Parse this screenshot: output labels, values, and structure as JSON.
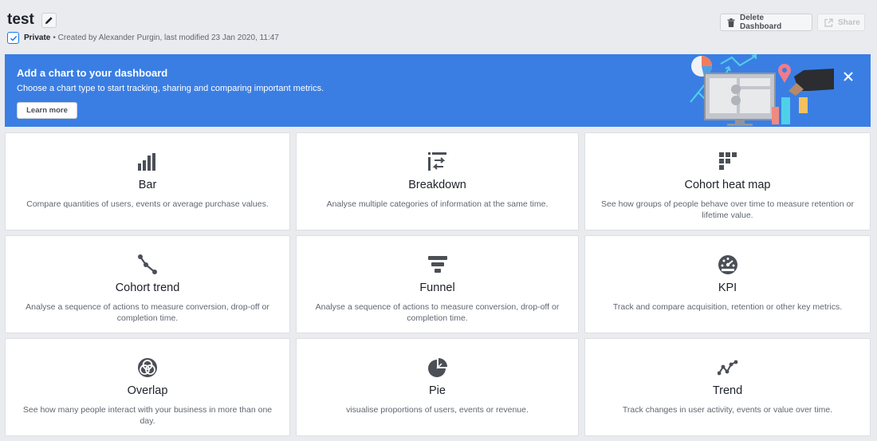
{
  "dashboard": {
    "title": "test",
    "privacy": "Private",
    "meta": "• Created by Alexander Purgin, last modified 23 Jan 2020, 11:47"
  },
  "header_buttons": {
    "delete_label": "Delete Dashboard",
    "share_label": "Share"
  },
  "banner": {
    "title": "Add a chart to your dashboard",
    "subtitle": "Choose a chart type to start tracking, sharing and comparing important metrics.",
    "learn_more_label": "Learn more"
  },
  "chart_types": [
    {
      "name": "Bar",
      "icon": "bar-chart-icon",
      "description": "Compare quantities of users, events or average purchase values."
    },
    {
      "name": "Breakdown",
      "icon": "breakdown-icon",
      "description": "Analyse multiple categories of information at the same time."
    },
    {
      "name": "Cohort heat map",
      "icon": "heat-map-icon",
      "description": "See how groups of people behave over time to measure retention or lifetime value."
    },
    {
      "name": "Cohort trend",
      "icon": "cohort-trend-icon",
      "description": "Analyse a sequence of actions to measure conversion, drop-off or completion time."
    },
    {
      "name": "Funnel",
      "icon": "funnel-icon",
      "description": "Analyse a sequence of actions to measure conversion, drop-off or completion time."
    },
    {
      "name": "KPI",
      "icon": "gauge-icon",
      "description": "Track and compare acquisition, retention or other key metrics."
    },
    {
      "name": "Overlap",
      "icon": "overlap-icon",
      "description": "See how many people interact with your business in more than one day."
    },
    {
      "name": "Pie",
      "icon": "pie-chart-icon",
      "description": "visualise proportions of users, events or revenue."
    },
    {
      "name": "Trend",
      "icon": "trend-icon",
      "description": "Track changes in user activity, events or value over time."
    }
  ],
  "colors": {
    "banner_bg": "#3a7ee4",
    "page_bg": "#e9ebee",
    "icon_color": "#4b4f56"
  }
}
